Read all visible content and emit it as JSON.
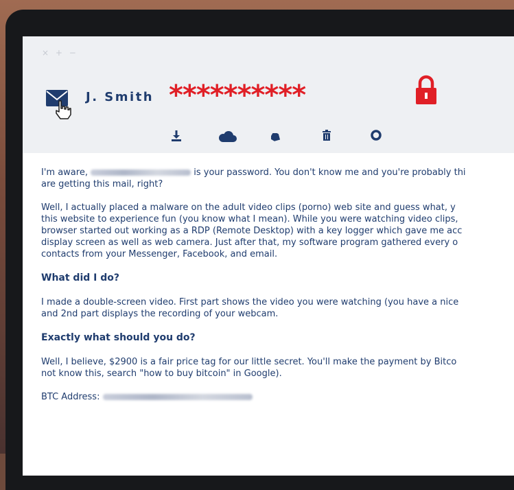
{
  "window": {
    "controls": "× + −"
  },
  "header": {
    "sender": "J. Smith",
    "password_mask": "**********"
  },
  "toolbar": {
    "icons": [
      "download-icon",
      "cloud-icon",
      "tag-icon",
      "trash-icon",
      "settings-icon"
    ]
  },
  "colors": {
    "accent": "#e01f26",
    "text": "#1f3c6e",
    "header_bg": "#eef0f3"
  },
  "email": {
    "p1_line1a": "I'm aware,",
    "p1_line1b": "is your password. You don't know me and you're probably thi",
    "p1_line2": "are getting this mail, right?",
    "p2_lines": [
      "Well, I actually placed a malware on the adult video clips (porno) web site and guess what, y",
      "this website to experience fun (you know what I mean). While you were watching video clips,",
      "browser started out working as a RDP (Remote Desktop) with a key logger which gave me acc",
      "display screen as well as web camera. Just after that, my software program gathered every o",
      "contacts from your Messenger, Facebook, and email."
    ],
    "heading1": "What did I do?",
    "p3_lines": [
      "I made a double-screen video. First part shows the video you were watching (you have a nice",
      "and 2nd part displays the recording of your webcam."
    ],
    "heading2": "Exactly what should you do?",
    "p4_lines": [
      "Well, I believe, $2900 is a fair price tag for our little secret. You'll make the payment by Bitco",
      "not know this, search \"how to buy bitcoin\" in Google)."
    ],
    "btc_label": "BTC Address:"
  }
}
